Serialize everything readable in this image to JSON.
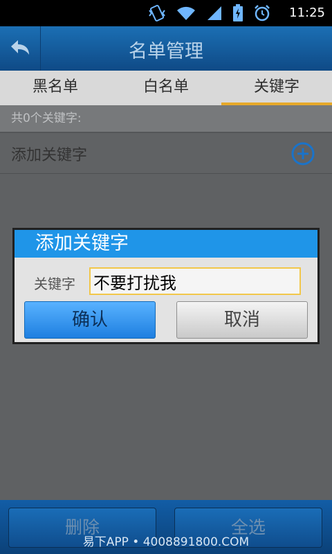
{
  "status_bar": {
    "time": "11:25",
    "icons": [
      "vibrate-icon",
      "wifi-icon",
      "signal-icon",
      "battery-icon",
      "alarm-icon"
    ]
  },
  "title_bar": {
    "title": "名单管理",
    "back_icon": "back-arrow-icon"
  },
  "tabs": [
    {
      "label": "黑名单",
      "active": false
    },
    {
      "label": "白名单",
      "active": false
    },
    {
      "label": "关键字",
      "active": true
    }
  ],
  "keyword_count": "共0个关键字:",
  "add_keyword_row": {
    "label": "添加关键字",
    "icon": "plus-circle-icon"
  },
  "dialog": {
    "title": "添加关键字",
    "field_label": "关键字",
    "field_value": "不要打扰我",
    "confirm_label": "确认",
    "cancel_label": "取消"
  },
  "bottom_bar": {
    "delete_label": "删除",
    "select_all_label": "全选"
  },
  "watermark": "易下APP • 4008891800.COM",
  "colors": {
    "accent": "#1f95e8",
    "tab_indicator": "#e6a92a",
    "title_bar": "#1b6fb4"
  }
}
